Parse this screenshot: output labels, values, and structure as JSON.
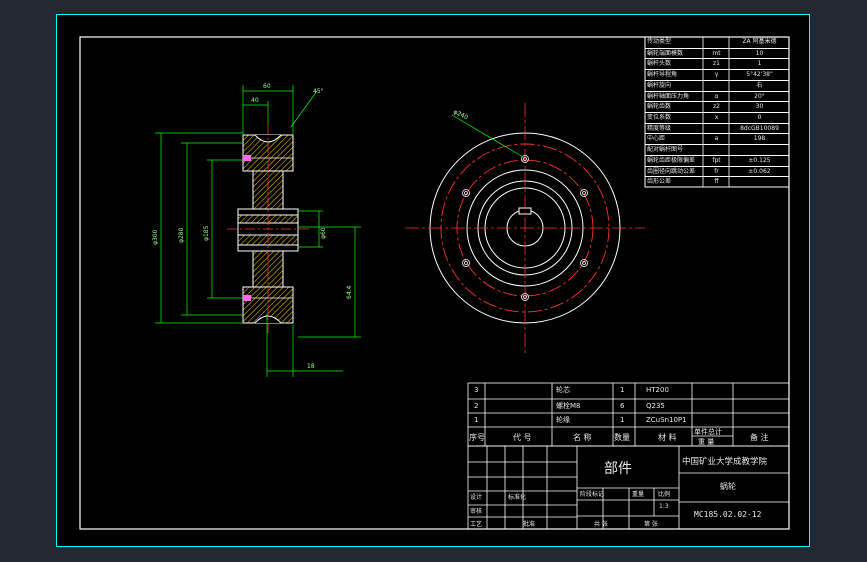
{
  "drawing": {
    "part_name": "部件",
    "institution": "中国矿业大学成教学院",
    "drawing_name": "蜗轮",
    "drawing_number": "MC185.02.02-12",
    "scale": "1:3",
    "labels": {
      "sequence": "序号",
      "code": "代  号",
      "name": "名  称",
      "quantity": "数量",
      "material": "材  料",
      "unit_weight": "单件总计",
      "weight": "重  量",
      "remarks": "备  注",
      "design": "设计",
      "review": "审核",
      "process": "工艺",
      "approve": "批准",
      "standardization": "标准化",
      "stage_mark": "阶段标记",
      "weight_short": "重量",
      "ratio": "比例",
      "sheet_total": "共  张",
      "sheet_no": "第  张"
    }
  },
  "parts_list": [
    {
      "no": "3",
      "name": "轮芯",
      "qty": "1",
      "material": "HT200"
    },
    {
      "no": "2",
      "name": "螺栓M8",
      "qty": "6",
      "material": "Q235"
    },
    {
      "no": "1",
      "name": "轮缘",
      "qty": "1",
      "material": "ZCuSn10P1"
    }
  ],
  "parameters": [
    {
      "label": "传动类型",
      "symbol": "",
      "value": "ZA 阿基米德"
    },
    {
      "label": "蜗轮端面模数",
      "symbol": "mt",
      "value": "10"
    },
    {
      "label": "蜗杆头数",
      "symbol": "z1",
      "value": "1"
    },
    {
      "label": "蜗杆导程角",
      "symbol": "γ",
      "value": "5°42'38\""
    },
    {
      "label": "蜗杆旋向",
      "symbol": "",
      "value": "右"
    },
    {
      "label": "蜗杆轴面压力角",
      "symbol": "α",
      "value": "20°"
    },
    {
      "label": "蜗轮齿数",
      "symbol": "z2",
      "value": "30"
    },
    {
      "label": "变位系数",
      "symbol": "x",
      "value": "0"
    },
    {
      "label": "精度等级",
      "symbol": "",
      "value": "8dcGB10089"
    },
    {
      "label": "中心距",
      "symbol": "a",
      "value": "198"
    },
    {
      "label": "配对蜗杆图号",
      "symbol": "",
      "value": ""
    },
    {
      "label": "蜗轮齿距极限偏差",
      "symbol": "fpt",
      "value": "±0.125"
    },
    {
      "label": "齿圈径向跳动公差",
      "symbol": "fr",
      "value": "±0.062"
    },
    {
      "label": "齿形公差",
      "symbol": "ff",
      "value": ""
    }
  ],
  "dimensions": {
    "d1": "φ300",
    "d2": "φ280",
    "d3": "φ185",
    "d4": "φ60",
    "key_depth": "64.4",
    "face_width": "60",
    "hub_width": "40",
    "key_width": "18",
    "angle": "45°",
    "bolt_circle": "φ240"
  },
  "colors": {
    "background": "#000000",
    "frame": "#ffffff",
    "border": "#00ffff",
    "geometry": "#ffffff",
    "centerline": "#ff3030",
    "dimension": "#00ff00",
    "hatch": "#ffd700",
    "text": "#e8e8e8"
  }
}
